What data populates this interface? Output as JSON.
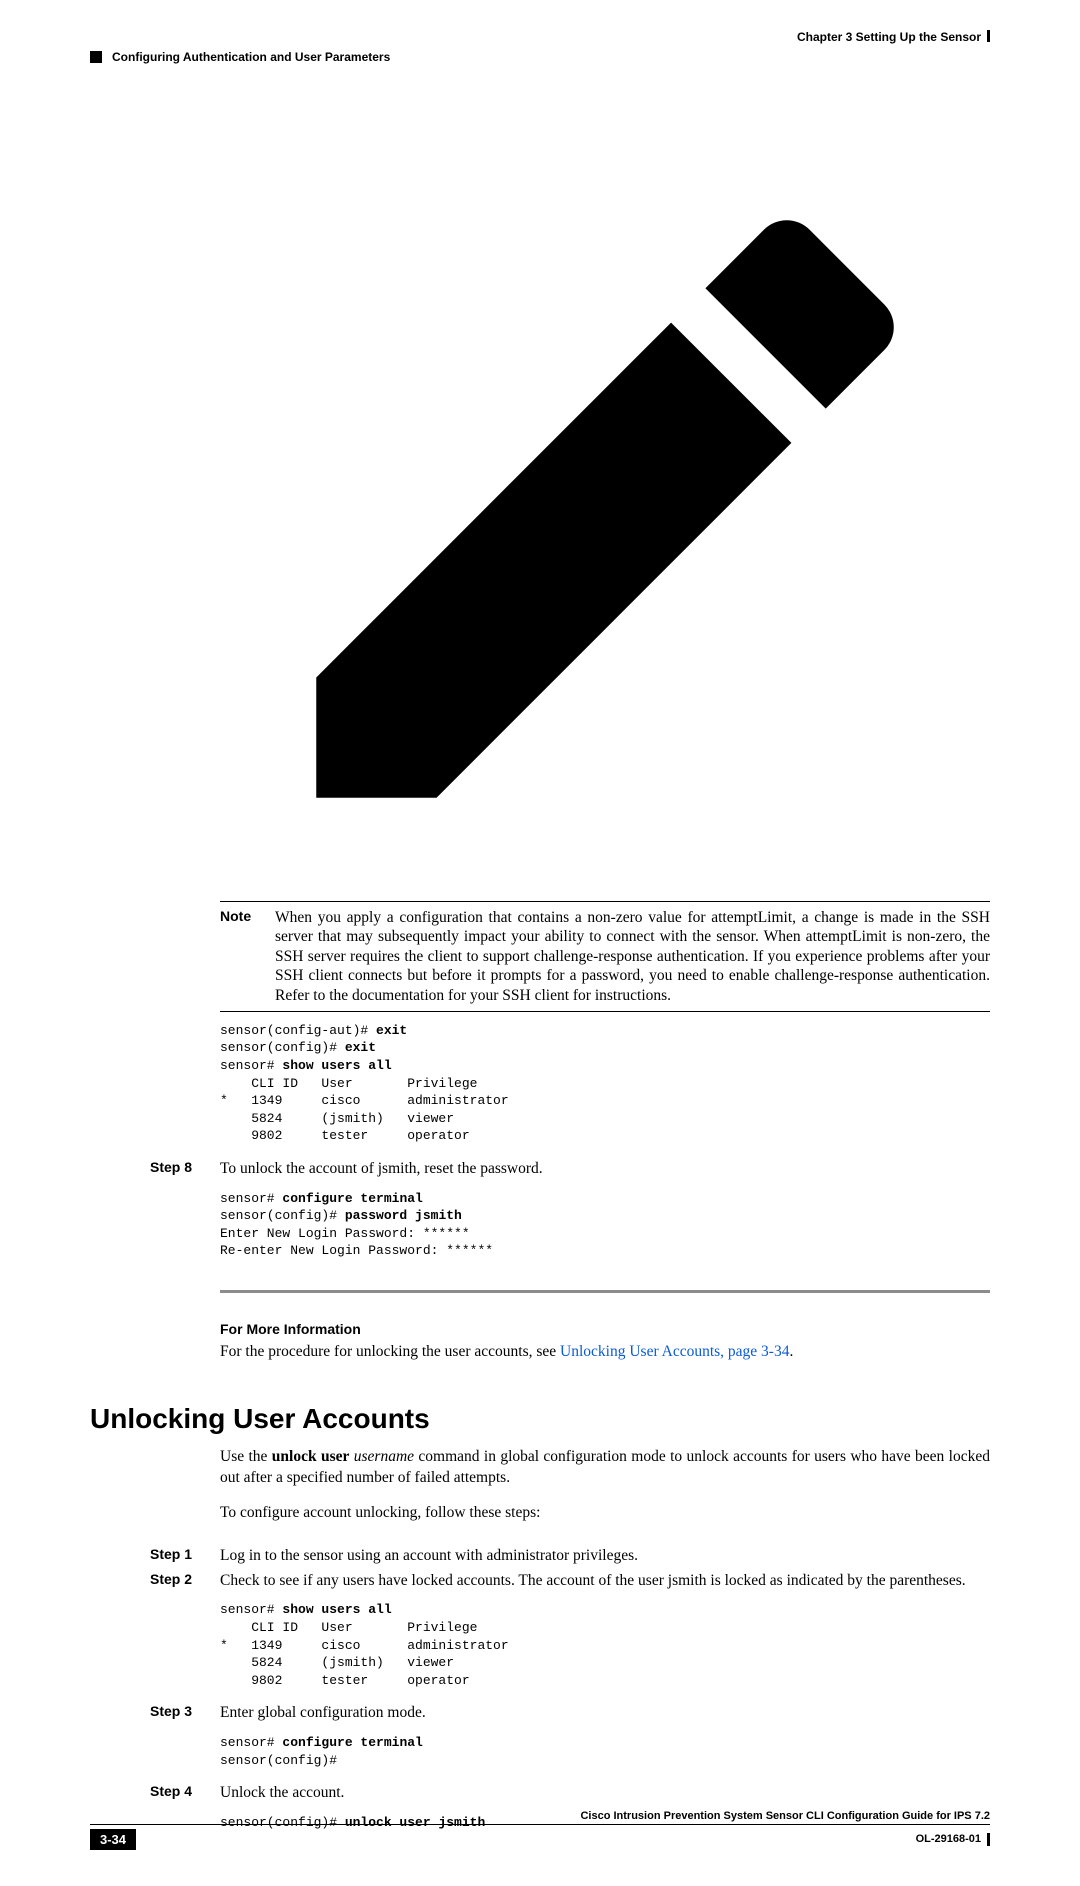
{
  "header": {
    "chapter": "Chapter 3      Setting Up the Sensor",
    "section": "Configuring Authentication and User Parameters"
  },
  "note": {
    "label": "Note",
    "text": "When you apply a configuration that contains a non-zero value for attemptLimit, a change is made in the SSH server that may subsequently impact your ability to connect with the sensor. When attemptLimit is non-zero, the SSH server requires the client to support challenge-response authentication. If you experience problems after your SSH client connects but before it prompts for a password, you need to enable challenge-response authentication. Refer to the documentation for your SSH client for instructions."
  },
  "cli1": {
    "l1a": "sensor(config-aut)# ",
    "l1b": "exit",
    "l2a": "sensor(config)# ",
    "l2b": "exit",
    "l3a": "sensor# ",
    "l3b": "show users all",
    "l4": "    CLI ID   User       Privilege",
    "l5": "*   1349     cisco      administrator",
    "l6": "    5824     (jsmith)   viewer",
    "l7": "    9802     tester     operator"
  },
  "step8": {
    "label": "Step 8",
    "text": "To unlock the account of jsmith, reset the password."
  },
  "cli2": {
    "l1a": "sensor# ",
    "l1b": "configure terminal",
    "l2a": "sensor(config)# ",
    "l2b": "password jsmith",
    "l3": "Enter New Login Password: ******",
    "l4": "Re-enter New Login Password: ******"
  },
  "fmi": {
    "heading": "For More Information",
    "text": "For the procedure for unlocking the user accounts, see ",
    "linktext": "Unlocking User Accounts, page 3-34",
    "after": "."
  },
  "section2": {
    "title": "Unlocking User Accounts",
    "intro_pre": "Use the ",
    "intro_cmd": "unlock user",
    "intro_space": " ",
    "intro_arg": "username",
    "intro_post": " command in global configuration mode to unlock accounts for users who have been locked out after a specified number of failed attempts.",
    "intro2": "To configure account unlocking, follow these steps:"
  },
  "s2steps": {
    "s1label": "Step 1",
    "s1text": "Log in to the sensor using an account with administrator privileges.",
    "s2label": "Step 2",
    "s2text": "Check to see if any users have locked accounts. The account of the user jsmith is locked as indicated by the parentheses.",
    "s3label": "Step 3",
    "s3text": "Enter global configuration mode.",
    "s4label": "Step 4",
    "s4text": "Unlock the account."
  },
  "cli3": {
    "l1a": "sensor# ",
    "l1b": "show users all",
    "l2": "    CLI ID   User       Privilege",
    "l3": "*   1349     cisco      administrator",
    "l4": "    5824     (jsmith)   viewer",
    "l5": "    9802     tester     operator"
  },
  "cli4": {
    "l1a": "sensor# ",
    "l1b": "configure terminal",
    "l2": "sensor(config)# "
  },
  "cli5": {
    "l1a": "sensor(config)# ",
    "l1b": "unlock user jsmith"
  },
  "footer": {
    "guide": "Cisco Intrusion Prevention System Sensor CLI Configuration Guide for IPS 7.2",
    "pagenum": "3-34",
    "docid": "OL-29168-01"
  }
}
